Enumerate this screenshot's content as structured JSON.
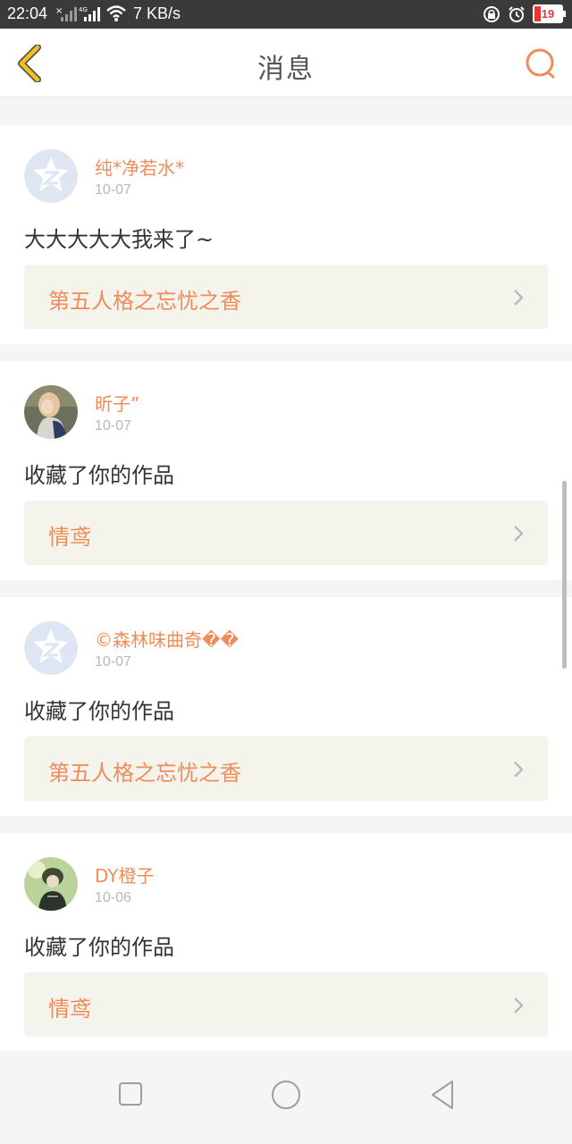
{
  "status": {
    "time": "22:04",
    "network_speed": "7 KB/s",
    "net_type": "4G",
    "battery": "19"
  },
  "header": {
    "title": "消息",
    "back_icon": "chevron-left-icon",
    "search_icon": "search-icon"
  },
  "messages": [
    {
      "user": "纯*净若水*",
      "date": "10-07",
      "text": "大大大大大我来了~",
      "work": "第五人格之忘忧之香",
      "avatar": "qq-default-avatar"
    },
    {
      "user": "昕子”",
      "date": "10-07",
      "text": "收藏了你的作品",
      "work": "情鸢",
      "avatar": "photo-avatar-girl"
    },
    {
      "user": "©森林味曲奇��",
      "date": "10-07",
      "text": "收藏了你的作品",
      "work": "第五人格之忘忧之香",
      "avatar": "qq-default-avatar"
    },
    {
      "user": "DY橙子",
      "date": "10-06",
      "text": "收藏了你的作品",
      "work": "情鸢",
      "avatar": "photo-avatar-character"
    }
  ],
  "colors": {
    "accent": "#f08b5a",
    "status_bar": "#3a3a3a",
    "work_bg": "#f4f4ec",
    "back_icon": "#f2c21a"
  }
}
